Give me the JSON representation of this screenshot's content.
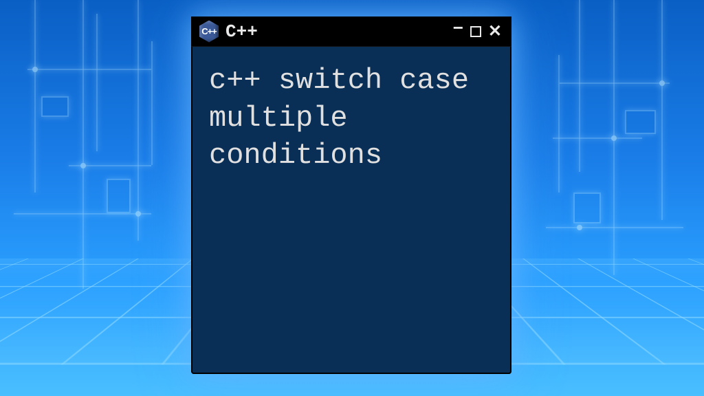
{
  "window": {
    "title": "C++",
    "icon_label": "C++",
    "controls": {
      "minimize": "−",
      "maximize": "□",
      "close": "✕"
    }
  },
  "terminal": {
    "content": "c++ switch case multiple conditions"
  },
  "colors": {
    "terminal_bg": "#0a2f56",
    "titlebar_bg": "#000000",
    "text": "#e0e0e0",
    "glow": "#64b4ff"
  }
}
